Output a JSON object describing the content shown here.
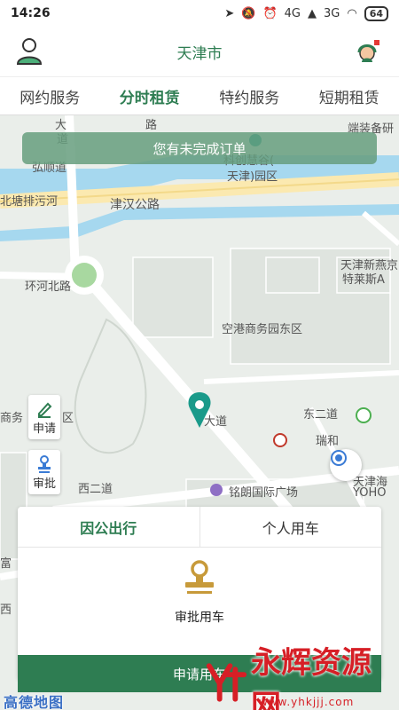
{
  "status_bar": {
    "time": "14:26",
    "signal_1": "4G",
    "signal_2": "3G",
    "battery": "64"
  },
  "header": {
    "city": "天津市"
  },
  "tabs": [
    {
      "label": "网约服务"
    },
    {
      "label": "分时租赁"
    },
    {
      "label": "特约服务"
    },
    {
      "label": "短期租赁"
    }
  ],
  "banner": {
    "text": "您有未完成订单"
  },
  "map": {
    "labels": {
      "road_1": "大",
      "road_1b": "道",
      "road_2": "路",
      "hongshun": "弘顺道",
      "beitang": "北塘排污河",
      "jinhan": "津汉公路",
      "huanhe": "环河北路",
      "konggang": "空港商务园东区",
      "yanzhao": "天津新燕京",
      "telaisi": "特莱斯A",
      "park_1": "科创慧谷(",
      "park_2": "天津)园区",
      "equip_1": "端装备研",
      "dongerdao": "东二道",
      "xierdao": "西二道",
      "ruihe": "瑞和",
      "mingleng": "铭朗国际广场",
      "tianjinhai": "天津海",
      "yoho": "YOHO",
      "shangwu": "商务",
      "qu": "区",
      "fu": "富",
      "xi": "西",
      "dadao": "大道"
    }
  },
  "side_buttons": {
    "apply": "申请",
    "approve": "审批"
  },
  "card": {
    "tab_business": "因公出行",
    "tab_personal": "个人用车",
    "approve_car": "审批用车"
  },
  "submit": {
    "label": "申请用车"
  },
  "map_logo": "高德地图",
  "watermark": {
    "text": "永辉资源网",
    "url": "www.yhkjjj.com"
  },
  "colors": {
    "brand_green": "#2e7d52",
    "river": "#a6d8ef",
    "road": "#ffffff",
    "accent_gold": "#c79a3a"
  }
}
